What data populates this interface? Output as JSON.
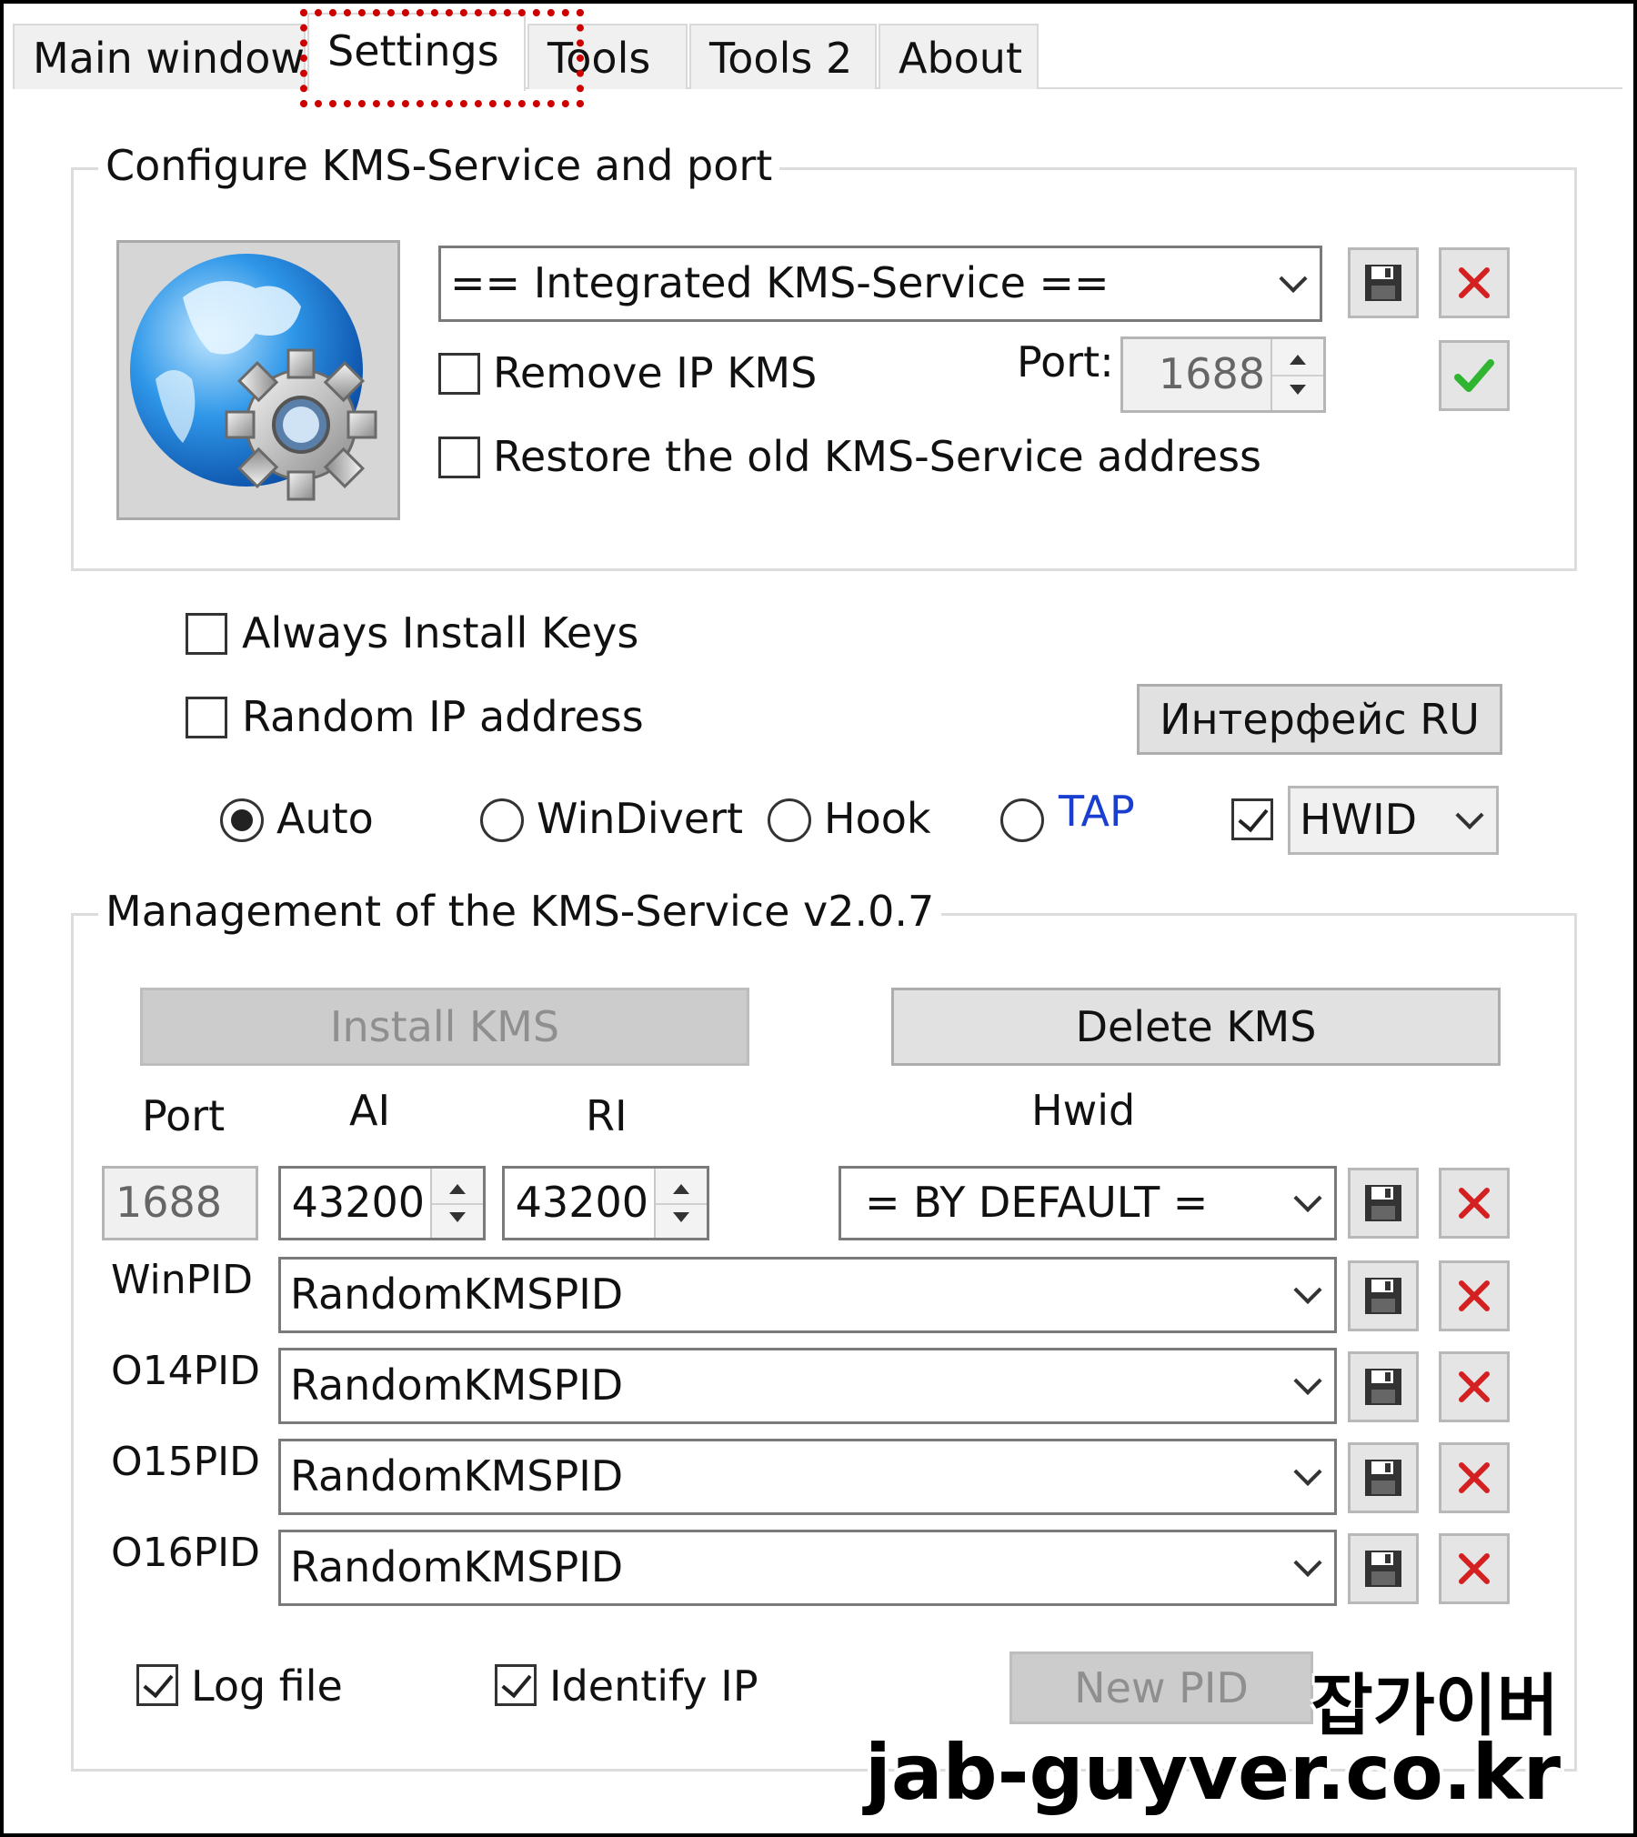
{
  "tabs": [
    {
      "label": "Main window"
    },
    {
      "label": "Settings",
      "active": true
    },
    {
      "label": "Tools"
    },
    {
      "label": "Tools 2"
    },
    {
      "label": "About"
    }
  ],
  "configure": {
    "title": "Configure KMS-Service and port",
    "service_combo": "== Integrated KMS-Service ==",
    "remove_ip_label": "Remove IP KMS",
    "remove_ip_checked": false,
    "port_label": "Port:",
    "port_value": "1688",
    "restore_label": "Restore the old KMS-Service address",
    "restore_checked": false
  },
  "options": {
    "always_install_label": "Always Install Keys",
    "always_install_checked": false,
    "random_ip_label": "Random IP address",
    "random_ip_checked": false,
    "interface_button": "Интерфейс RU",
    "radios": [
      {
        "label": "Auto",
        "selected": true
      },
      {
        "label": "WinDivert",
        "selected": false
      },
      {
        "label": "Hook",
        "selected": false
      },
      {
        "label": "TAP",
        "selected": false
      }
    ],
    "hwid_checked": true,
    "hwid_combo": "HWID"
  },
  "management": {
    "title": "Management of the KMS-Service v2.0.7",
    "install_button": "Install KMS",
    "delete_button": "Delete KMS",
    "headers": {
      "port": "Port",
      "ai": "AI",
      "ri": "RI",
      "hwid": "Hwid"
    },
    "port_value": "1688",
    "ai_value": "43200",
    "ri_value": "43200",
    "hwid_combo": "= BY DEFAULT =",
    "pid_rows": [
      {
        "label": "WinPID",
        "value": "RandomKMSPID"
      },
      {
        "label": "O14PID",
        "value": "RandomKMSPID"
      },
      {
        "label": "O15PID",
        "value": "RandomKMSPID"
      },
      {
        "label": "O16PID",
        "value": "RandomKMSPID"
      }
    ],
    "log_file_label": "Log file",
    "log_file_checked": true,
    "identify_ip_label": "Identify IP",
    "identify_ip_checked": true,
    "new_pid_button": "New PID"
  },
  "watermark": {
    "line1": "잡가이버",
    "line2": "jab-guyver.co.kr"
  },
  "colors": {
    "tap_label": "#1a3fd0",
    "delete_x": "#d42020",
    "ok_check": "#2fb52f",
    "highlight": "#cc0000"
  }
}
